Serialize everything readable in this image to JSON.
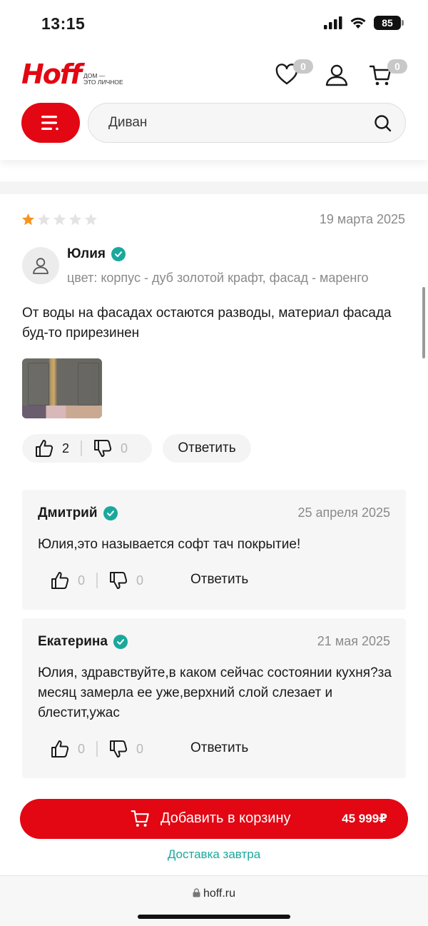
{
  "status": {
    "time": "13:15",
    "battery": "85"
  },
  "header": {
    "logo": "Hoff",
    "tagline": "дом —\nэто личное",
    "favorites_count": "0",
    "cart_count": "0",
    "search_value": "Диван"
  },
  "review": {
    "rating": 1,
    "rating_max": 5,
    "date": "19 марта 2025",
    "author": "Юлия",
    "variant": "цвет: корпус - дуб золотой крафт, фасад - маренго",
    "text": "От воды на фасадах остаются разводы, материал фасада буд-то прирезинен",
    "likes": "2",
    "dislikes": "0",
    "reply_label": "Ответить"
  },
  "comments": [
    {
      "author": "Дмитрий",
      "date": "25 апреля 2025",
      "text": "Юлия,это называется софт тач покрытие!",
      "likes": "0",
      "dislikes": "0",
      "reply_label": "Ответить"
    },
    {
      "author": "Екатерина",
      "date": "21 мая 2025",
      "text": "Юлия, здравствуйте,в каком сейчас состоянии кухня?за месяц замерла ее уже,верхний слой слезает и блестит,ужас",
      "likes": "0",
      "dislikes": "0",
      "reply_label": "Ответить"
    }
  ],
  "cart": {
    "label": "Добавить в корзину",
    "price": "45 999₽",
    "delivery": "Доставка завтра"
  },
  "browser": {
    "url": "hoff.ru"
  },
  "colors": {
    "brand": "#e30613",
    "accent": "#1ba89c",
    "star": "#f7931e"
  }
}
